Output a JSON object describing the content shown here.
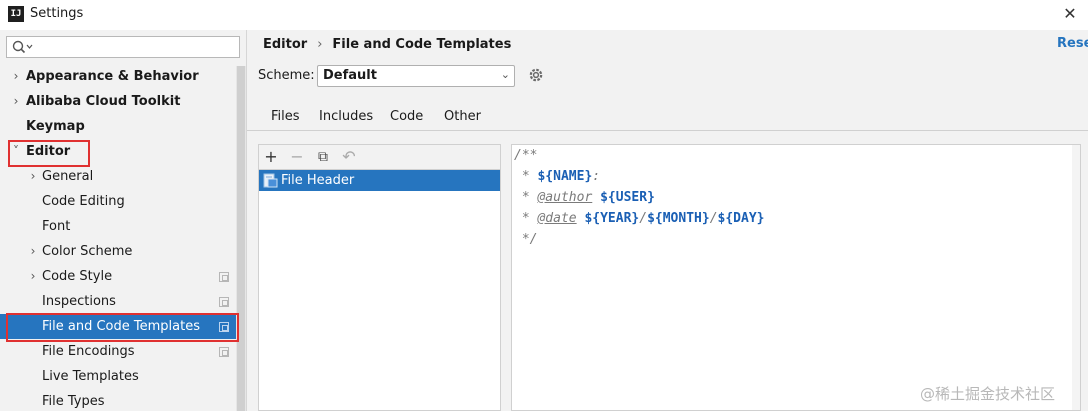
{
  "window": {
    "app_icon": "IJ",
    "title": "Settings",
    "close_icon": "close-icon"
  },
  "search": {
    "placeholder": "Q•",
    "icon": "search-icon"
  },
  "sidebar": {
    "items": [
      {
        "label": "Appearance & Behavior",
        "arrow": "›",
        "bold": true
      },
      {
        "label": "Alibaba Cloud Toolkit",
        "arrow": "›",
        "bold": true
      },
      {
        "label": "Keymap",
        "arrow": "",
        "bold": true
      },
      {
        "label": "Editor",
        "arrow": "˅",
        "bold": true
      },
      {
        "label": "General",
        "arrow": "›",
        "bold": false
      },
      {
        "label": "Code Editing",
        "arrow": "",
        "bold": false
      },
      {
        "label": "Font",
        "arrow": "",
        "bold": false
      },
      {
        "label": "Color Scheme",
        "arrow": "›",
        "bold": false
      },
      {
        "label": "Code Style",
        "arrow": "›",
        "bold": false
      },
      {
        "label": "Inspections",
        "arrow": "",
        "bold": false
      },
      {
        "label": "File and Code Templates",
        "arrow": "",
        "bold": false,
        "selected": true
      },
      {
        "label": "File Encodings",
        "arrow": "",
        "bold": false
      },
      {
        "label": "Live Templates",
        "arrow": "",
        "bold": false
      },
      {
        "label": "File Types",
        "arrow": "",
        "bold": false
      }
    ]
  },
  "breadcrumb": {
    "parent": "Editor",
    "separator": "›",
    "current": "File and Code Templates"
  },
  "reset_label": "Reset",
  "scheme": {
    "label": "Scheme:",
    "value": "Default",
    "chevron": "⌄"
  },
  "tabs": [
    {
      "label": "Files"
    },
    {
      "label": "Includes",
      "active": true
    },
    {
      "label": "Code"
    },
    {
      "label": "Other"
    }
  ],
  "toolbar": {
    "add": "+",
    "remove": "−",
    "copy": "⧉",
    "reset": "↶"
  },
  "templates": [
    {
      "name": "File Header",
      "icon": "java-file-icon"
    }
  ],
  "code": {
    "l1": "/**",
    "l2_prefix": " * ",
    "l2_var": "${NAME}",
    "l2_suffix": ":",
    "l3_prefix": " * ",
    "l3_tag": "@author",
    "l3_var": "${USER}",
    "l4_prefix": " * ",
    "l4_tag": "@date",
    "l4_year": "${YEAR}",
    "l4_slash1": "/",
    "l4_month": "${MONTH}",
    "l4_slash2": "/",
    "l4_day": "${DAY}",
    "l5": " */"
  },
  "watermark": "@稀土掘金技术社区",
  "colors": {
    "accent": "#2675bf",
    "highlight_box": "#e03131"
  }
}
